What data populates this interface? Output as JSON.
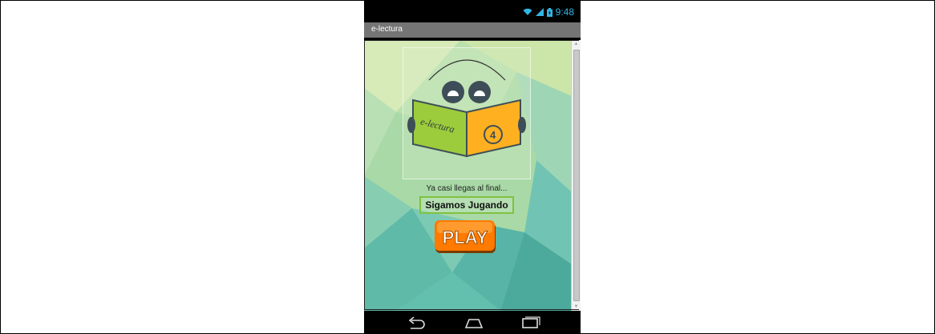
{
  "statusbar": {
    "time": "9:48",
    "icons": [
      "wifi-icon",
      "signal-icon",
      "battery-icon"
    ]
  },
  "app": {
    "title": "e-lectura"
  },
  "logo": {
    "book_text": "e-lectura",
    "badge_number": "4"
  },
  "main": {
    "subtitle": "Ya casi llegas al final...",
    "label": "Sigamos Jugando",
    "play_label": "PLAY"
  },
  "navbar": {
    "buttons": [
      "back-icon",
      "home-icon",
      "recent-apps-icon"
    ]
  },
  "colors": {
    "accent": "#33b5e5",
    "titlebar": "#757575",
    "play_orange": "#ff7a00",
    "book_green": "#9ccc3c",
    "book_orange": "#ffb020",
    "label_border": "#7fc241"
  }
}
